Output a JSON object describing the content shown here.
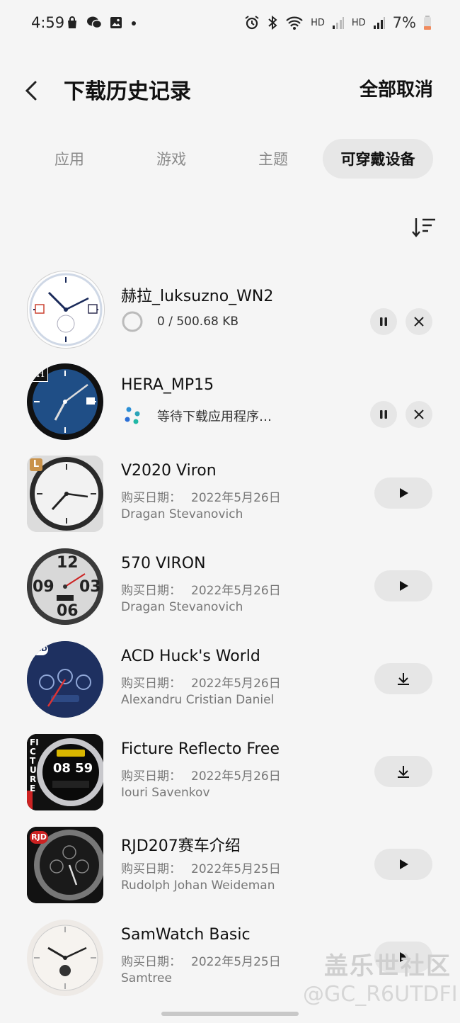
{
  "status_bar": {
    "time": "4:59",
    "hd1": "HD",
    "hd2": "HD",
    "battery": "7%"
  },
  "header": {
    "title": "下载历史记录",
    "cancel_all": "全部取消"
  },
  "tabs": [
    {
      "label": "应用",
      "active": false
    },
    {
      "label": "游戏",
      "active": false
    },
    {
      "label": "主题",
      "active": false
    },
    {
      "label": "可穿戴设备",
      "active": true
    }
  ],
  "items": [
    {
      "name": "赫拉_luksuzno_WN2",
      "progress": "0 / 500.68 KB",
      "state": "downloading"
    },
    {
      "name": "HERA_MP15",
      "status": "等待下载应用程序…",
      "state": "waiting"
    },
    {
      "name": "V2020 Viron",
      "date_label": "购买日期：",
      "date": "2022年5月26日",
      "author": "Dragan Stevanovich",
      "action": "play"
    },
    {
      "name": "570 VIRON",
      "date_label": "购买日期：",
      "date": "2022年5月26日",
      "author": "Dragan Stevanovich",
      "action": "play"
    },
    {
      "name": "ACD Huck's World",
      "date_label": "购买日期：",
      "date": "2022年5月26日",
      "author": "Alexandru Cristian Daniel",
      "action": "download"
    },
    {
      "name": "Ficture Reflecto Free",
      "date_label": "购买日期：",
      "date": "2022年5月26日",
      "author": "Iouri Savenkov",
      "action": "download"
    },
    {
      "name": "RJD207赛车介绍",
      "date_label": "购买日期：",
      "date": "2022年5月25日",
      "author": "Rudolph Johan Weideman",
      "action": "play"
    },
    {
      "name": "SamWatch Basic",
      "date_label": "购买日期：",
      "date": "2022年5月25日",
      "author": "Samtree",
      "action": "play"
    }
  ],
  "thumb_text": {
    "hera_badge": "H",
    "v2020_badge": "L",
    "viron_12": "12",
    "viron_09": "09",
    "viron_03": "03",
    "viron_06": "06",
    "acd_badge": "ACD",
    "ficture_brand": "FICTURE",
    "ficture_time": "08 59",
    "rjd_badge": "RJD"
  },
  "watermark": {
    "line1": "盖乐世社区",
    "line2": "@GC_R6UTDFI"
  }
}
